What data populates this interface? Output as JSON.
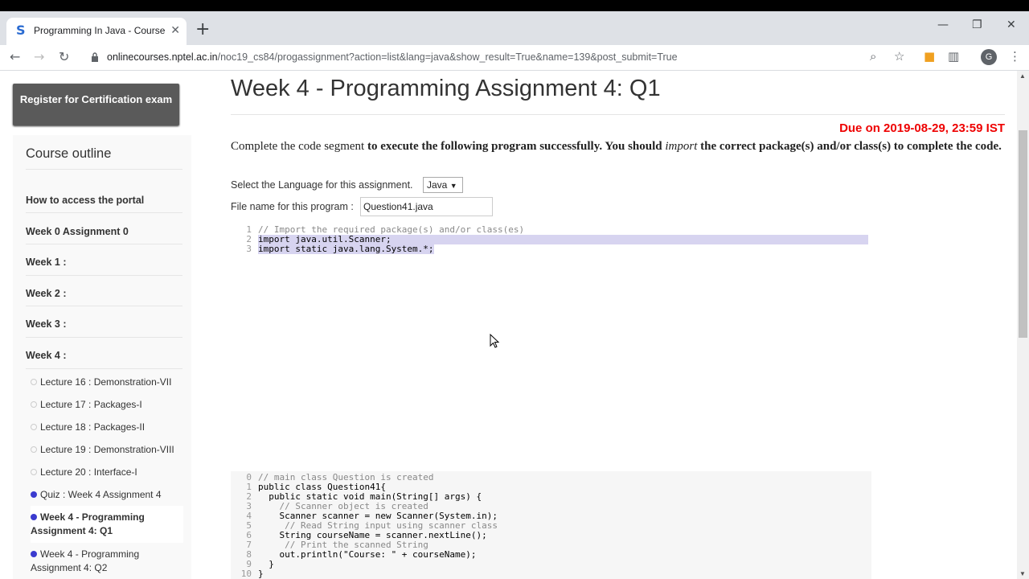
{
  "browser": {
    "tab_title": "Programming In Java - Course",
    "tab_favicon": "S",
    "url_domain": "onlinecourses.nptel.ac.in",
    "url_path": "/noc19_cs84/progassignment?action=list&lang=java&show_result=True&name=139&post_submit=True",
    "avatar_letter": "G",
    "icons": [
      "back-icon",
      "forward-icon",
      "reload-icon",
      "lock-icon",
      "zoom-icon",
      "star-icon",
      "extension-icon",
      "chart-extension-icon",
      "menu-icon"
    ]
  },
  "sidebar": {
    "register_label": "Register for Certification exam",
    "outline_title": "Course outline",
    "weeks": [
      "How to access the portal",
      "Week 0 Assignment 0",
      "Week 1 :",
      "Week 2 :",
      "Week 3 :",
      "Week 4 :"
    ],
    "lectures": [
      "Lecture 16 : Demonstration-VII",
      "Lecture 17 : Packages-I",
      "Lecture 18 : Packages-II",
      "Lecture 19 : Demonstration-VIII",
      "Lecture 20 : Interface-I",
      "Quiz : Week 4 Assignment 4",
      "Week 4 - Programming Assignment 4: Q1",
      "Week 4 - Programming Assignment 4: Q2"
    ]
  },
  "main": {
    "title": "Week 4 - Programming Assignment 4: Q1",
    "due": "Due on 2019-08-29, 23:59 IST",
    "desc_part1": "Complete the code segment ",
    "desc_part2": "to execute the following program successfully. You should ",
    "desc_italic": "import",
    "desc_part3": " the correct package(s) and/or class(s) to complete the code.",
    "lang_label": "Select the Language for this assignment.",
    "lang_value": "Java",
    "file_label": "File name for this program :",
    "file_value": "Question41.java"
  },
  "editor": {
    "lines": [
      {
        "n": "1",
        "t": "// Import the required package(s) and/or class(es)"
      },
      {
        "n": "2",
        "t": "import java.util.Scanner;"
      },
      {
        "n": "3",
        "t": "import static java.lang.System.*;"
      }
    ]
  },
  "template_code": {
    "lines": [
      {
        "n": "0",
        "t": "// main class Question is created"
      },
      {
        "n": "1",
        "t": "public class Question41{"
      },
      {
        "n": "2",
        "t": "  public static void main(String[] args) {"
      },
      {
        "n": "3",
        "t": "    // Scanner object is created"
      },
      {
        "n": "4",
        "t": "    Scanner scanner = new Scanner(System.in);"
      },
      {
        "n": "5",
        "t": "     // Read String input using scanner class"
      },
      {
        "n": "6",
        "t": "    String courseName = scanner.nextLine();"
      },
      {
        "n": "7",
        "t": "     // Print the scanned String"
      },
      {
        "n": "8",
        "t": "    out.println(\"Course: \" + courseName);"
      },
      {
        "n": "9",
        "t": "  }"
      },
      {
        "n": "10",
        "t": "}"
      }
    ]
  }
}
